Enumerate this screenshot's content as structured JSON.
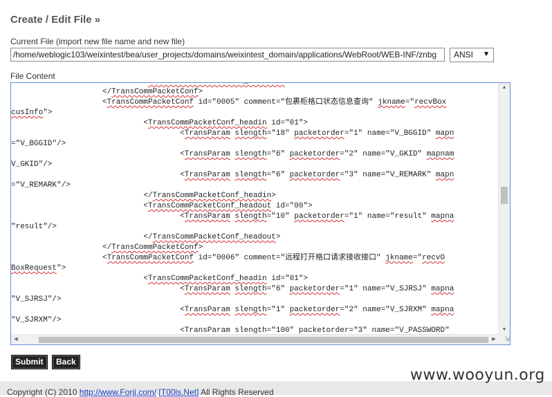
{
  "page": {
    "title": "Create / Edit File »",
    "current_file_label": "Current File (import new file name and new file)",
    "current_file_value": "/home/weblogic103/weixintest/bea/user_projects/domains/weixintest_domain/applications/WebRoot/WEB-INF/znbg",
    "encoding_value": "ANSI",
    "file_content_label": "File Content"
  },
  "editor": {
    "lines": [
      {
        "indent": 30,
        "segments": [
          {
            "t": "</TransCommPacketConf_headout>",
            "sq": true
          }
        ]
      },
      {
        "indent": 20,
        "segments": [
          {
            "t": "</",
            "sq": false
          },
          {
            "t": "TransCommPacketConf",
            "sq": true
          },
          {
            "t": ">",
            "sq": false
          }
        ]
      },
      {
        "indent": 20,
        "segments": [
          {
            "t": "<",
            "sq": false
          },
          {
            "t": "TransCommPacketConf",
            "sq": true
          },
          {
            "t": " id=\"0005\" comment=\"包裹柜格口状态信息查询\" ",
            "sq": false
          },
          {
            "t": "jkname",
            "sq": true
          },
          {
            "t": "=\"",
            "sq": false
          },
          {
            "t": "recvBox",
            "sq": true
          }
        ]
      },
      {
        "indent": 0,
        "segments": [
          {
            "t": "cusInfo",
            "sq": true
          },
          {
            "t": "\">",
            "sq": false
          }
        ]
      },
      {
        "indent": 29,
        "segments": [
          {
            "t": "<",
            "sq": false
          },
          {
            "t": "TransCommPacketConf_headin",
            "sq": true
          },
          {
            "t": " id=\"01\">",
            "sq": false
          }
        ]
      },
      {
        "indent": 37,
        "segments": [
          {
            "t": "<",
            "sq": false
          },
          {
            "t": "TransParam",
            "sq": true
          },
          {
            "t": " ",
            "sq": false
          },
          {
            "t": "slength",
            "sq": true
          },
          {
            "t": "=\"18\" ",
            "sq": false
          },
          {
            "t": "packetorder",
            "sq": true
          },
          {
            "t": "=\"1\" name=\"V_BGGID\" ",
            "sq": false
          },
          {
            "t": "mapn",
            "sq": true
          }
        ]
      },
      {
        "indent": 0,
        "segments": [
          {
            "t": "=\"V_BGGID\"/>",
            "sq": false
          }
        ]
      },
      {
        "indent": 37,
        "segments": [
          {
            "t": "<",
            "sq": false
          },
          {
            "t": "TransParam",
            "sq": true
          },
          {
            "t": " ",
            "sq": false
          },
          {
            "t": "slength",
            "sq": true
          },
          {
            "t": "=\"6\" ",
            "sq": false
          },
          {
            "t": "packetorder",
            "sq": true
          },
          {
            "t": "=\"2\" name=\"V_GKID\" ",
            "sq": false
          },
          {
            "t": "mapnam",
            "sq": true
          }
        ]
      },
      {
        "indent": 0,
        "segments": [
          {
            "t": "V_GKID\"/>",
            "sq": false
          }
        ]
      },
      {
        "indent": 37,
        "segments": [
          {
            "t": "<",
            "sq": false
          },
          {
            "t": "TransParam",
            "sq": true
          },
          {
            "t": " ",
            "sq": false
          },
          {
            "t": "slength",
            "sq": true
          },
          {
            "t": "=\"6\" ",
            "sq": false
          },
          {
            "t": "packetorder",
            "sq": true
          },
          {
            "t": "=\"3\" name=\"V_REMARK\" ",
            "sq": false
          },
          {
            "t": "mapn",
            "sq": true
          }
        ]
      },
      {
        "indent": 0,
        "segments": [
          {
            "t": "=\"V_REMARK\"/>",
            "sq": false
          }
        ]
      },
      {
        "indent": 29,
        "segments": [
          {
            "t": "</",
            "sq": false
          },
          {
            "t": "TransCommPacketConf_headin",
            "sq": true
          },
          {
            "t": ">",
            "sq": false
          }
        ]
      },
      {
        "indent": 29,
        "segments": [
          {
            "t": "<",
            "sq": false
          },
          {
            "t": "TransCommPacketConf_headout",
            "sq": true
          },
          {
            "t": " id=\"00\">",
            "sq": false
          }
        ]
      },
      {
        "indent": 37,
        "segments": [
          {
            "t": "<",
            "sq": false
          },
          {
            "t": "TransParam",
            "sq": true
          },
          {
            "t": " ",
            "sq": false
          },
          {
            "t": "slength",
            "sq": true
          },
          {
            "t": "=\"10\" ",
            "sq": false
          },
          {
            "t": "packetorder",
            "sq": true
          },
          {
            "t": "=\"1\" name=\"result\" ",
            "sq": false
          },
          {
            "t": "mapna",
            "sq": true
          }
        ]
      },
      {
        "indent": 0,
        "segments": [
          {
            "t": "\"result\"/>",
            "sq": false
          }
        ]
      },
      {
        "indent": 29,
        "segments": [
          {
            "t": "</",
            "sq": false
          },
          {
            "t": "TransCommPacketConf_headout",
            "sq": true
          },
          {
            "t": ">",
            "sq": false
          }
        ]
      },
      {
        "indent": 20,
        "segments": [
          {
            "t": "</",
            "sq": false
          },
          {
            "t": "TransCommPacketConf",
            "sq": true
          },
          {
            "t": ">",
            "sq": false
          }
        ]
      },
      {
        "indent": 20,
        "segments": [
          {
            "t": "<",
            "sq": false
          },
          {
            "t": "TransCommPacketConf",
            "sq": true
          },
          {
            "t": " id=\"0006\" comment=\"远程打开格口请求接收接口\" ",
            "sq": false
          },
          {
            "t": "jkname",
            "sq": true
          },
          {
            "t": "=\"",
            "sq": false
          },
          {
            "t": "recvO",
            "sq": true
          }
        ]
      },
      {
        "indent": 0,
        "segments": [
          {
            "t": "BoxRequest",
            "sq": true
          },
          {
            "t": "\">",
            "sq": false
          }
        ]
      },
      {
        "indent": 29,
        "segments": [
          {
            "t": "<",
            "sq": false
          },
          {
            "t": "TransCommPacketConf_headin",
            "sq": true
          },
          {
            "t": " id=\"01\">",
            "sq": false
          }
        ]
      },
      {
        "indent": 37,
        "segments": [
          {
            "t": "<",
            "sq": false
          },
          {
            "t": "TransParam",
            "sq": true
          },
          {
            "t": " ",
            "sq": false
          },
          {
            "t": "slength",
            "sq": true
          },
          {
            "t": "=\"6\" ",
            "sq": false
          },
          {
            "t": "packetorder",
            "sq": true
          },
          {
            "t": "=\"1\" name=\"V_SJRSJ\" ",
            "sq": false
          },
          {
            "t": "mapna",
            "sq": true
          }
        ]
      },
      {
        "indent": 0,
        "segments": [
          {
            "t": "\"V_SJRSJ\"/>",
            "sq": false
          }
        ]
      },
      {
        "indent": 37,
        "segments": [
          {
            "t": "<",
            "sq": false
          },
          {
            "t": "TransParam",
            "sq": true
          },
          {
            "t": " ",
            "sq": false
          },
          {
            "t": "slength",
            "sq": true
          },
          {
            "t": "=\"1\" ",
            "sq": false
          },
          {
            "t": "packetorder",
            "sq": true
          },
          {
            "t": "=\"2\" name=\"V_SJRXM\" ",
            "sq": false
          },
          {
            "t": "mapna",
            "sq": true
          }
        ]
      },
      {
        "indent": 0,
        "segments": [
          {
            "t": "\"V_SJRXM\"/>",
            "sq": false
          }
        ]
      },
      {
        "indent": 37,
        "segments": [
          {
            "t": "<",
            "sq": false
          },
          {
            "t": "TransParam",
            "sq": true
          },
          {
            "t": " ",
            "sq": false
          },
          {
            "t": "slength",
            "sq": true
          },
          {
            "t": "=\"100\" ",
            "sq": false
          },
          {
            "t": "packetorder",
            "sq": true
          },
          {
            "t": "=\"3\" name=\"V_PASSWORD\" ",
            "sq": false
          }
        ]
      }
    ]
  },
  "buttons": {
    "submit": "Submit",
    "back": "Back"
  },
  "footer": {
    "copyright": "Copyright (C) 2010 ",
    "link1": "http://www.Forjj.com/",
    "link2": "[T00ls.Net]",
    "rights": " All Rights Reserved"
  },
  "watermark": "www.wooyun.org",
  "icons": {
    "encoding_dropdown": "triangle-down-icon",
    "scroll_up": "triangle-up-icon",
    "scroll_down": "triangle-down-icon",
    "scroll_left": "triangle-left-icon",
    "scroll_right": "triangle-right-icon",
    "resize": "resize-grip-icon"
  },
  "colors": {
    "editor_border": "#5f8fd6",
    "spellcheck_underline": "#d43030",
    "link": "#1a3dbd"
  }
}
